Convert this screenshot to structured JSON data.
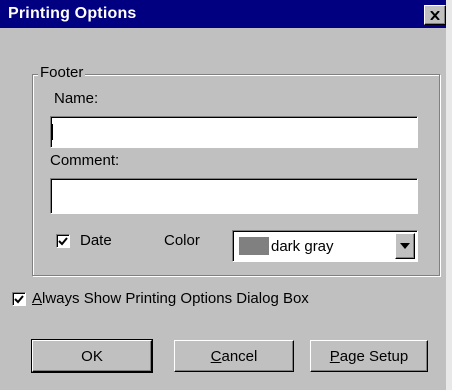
{
  "window": {
    "title": "Printing Options"
  },
  "footer": {
    "group_label": "Footer",
    "name_label": "Name:",
    "name_value": "",
    "comment_label": "Comment:",
    "comment_value": "",
    "date_label": "Date",
    "date_checked": true,
    "color_label": "Color",
    "color_value": "dark gray",
    "color_swatch": "#808080"
  },
  "always_show": {
    "label_underlined": "A",
    "label_rest": "lways Show Printing Options Dialog Box",
    "checked": true
  },
  "buttons": {
    "ok": "OK",
    "cancel_underlined": "C",
    "cancel_rest": "ancel",
    "page_setup_underlined": "P",
    "page_setup_rest": "age Setup"
  },
  "icons": {
    "close": "close-icon",
    "check": "check-icon",
    "dropdown": "chevron-down-icon"
  }
}
